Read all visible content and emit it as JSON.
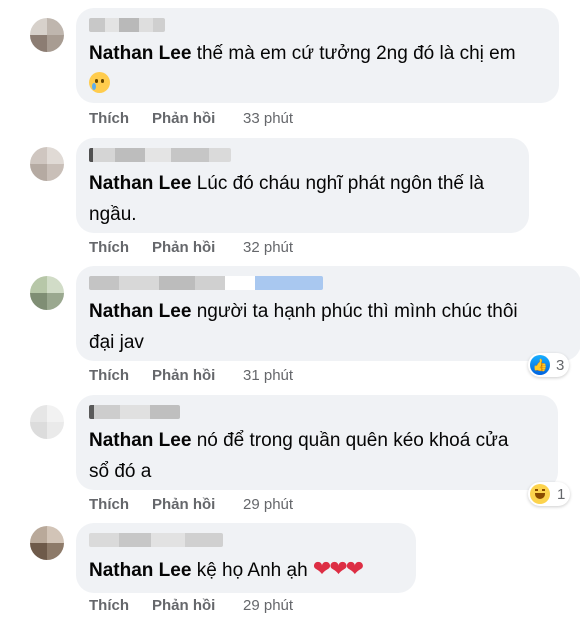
{
  "comments": [
    {
      "mention": "Nathan Lee",
      "text": "thế mà em cứ tưởng 2ng đó là chị em",
      "emoji": "sad-tear-face",
      "actions": {
        "like": "Thích",
        "reply": "Phản hồi",
        "time": "33 phút"
      }
    },
    {
      "mention": "Nathan Lee",
      "text": "Lúc đó cháu nghĩ phát ngôn thế là",
      "text2": "ngầu.",
      "actions": {
        "like": "Thích",
        "reply": "Phản hồi",
        "time": "32 phút"
      }
    },
    {
      "mention": "Nathan Lee",
      "text": "người ta hạnh phúc thì mình chúc thôi",
      "text2": "đại jav",
      "reaction": {
        "icon": "like-reaction-icon",
        "count": "3"
      },
      "actions": {
        "like": "Thích",
        "reply": "Phản hồi",
        "time": "31 phút"
      }
    },
    {
      "mention": "Nathan Lee",
      "text": "nó để trong quần quên kéo khoá cửa",
      "text2": "sổ đó a",
      "reaction": {
        "icon": "haha-reaction-icon",
        "count": "1"
      },
      "actions": {
        "like": "Thích",
        "reply": "Phản hồi",
        "time": "29 phút"
      }
    },
    {
      "mention": "Nathan Lee",
      "text": "kệ họ Anh ạh",
      "emoji": "three-red-hearts",
      "actions": {
        "like": "Thích",
        "reply": "Phản hồi",
        "time": "29 phút"
      }
    }
  ],
  "colors": {
    "bubble": "#f0f2f5",
    "action_text": "#65676b",
    "like_blue": "#1877f2",
    "heart_red": "#dd2e44"
  },
  "glyphs": {
    "heart": "❤",
    "like": "👍"
  }
}
